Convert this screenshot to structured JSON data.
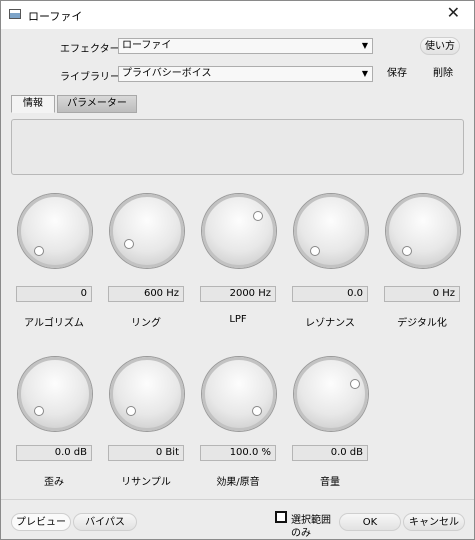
{
  "window": {
    "title": "ローファイ"
  },
  "effector": {
    "label": "エフェクター",
    "value": "ローファイ",
    "usage_button": "使い方"
  },
  "library": {
    "label": "ライブラリー",
    "value": "プライバシーボイス",
    "save_button": "保存",
    "delete_button": "削除"
  },
  "tabs": [
    {
      "label": "情報",
      "active": true
    },
    {
      "label": "パラメーター",
      "active": false
    }
  ],
  "knobs": [
    {
      "label": "アルゴリズム",
      "value": "0"
    },
    {
      "label": "リング",
      "value": "600 Hz"
    },
    {
      "label": "LPF",
      "value": "2000 Hz"
    },
    {
      "label": "レゾナンス",
      "value": "0.0"
    },
    {
      "label": "デジタル化",
      "value": "0 Hz"
    },
    {
      "label": "歪み",
      "value": "0.0 dB"
    },
    {
      "label": "リサンプル",
      "value": "0 Bit"
    },
    {
      "label": "効果/原音",
      "value": "100.0 %"
    },
    {
      "label": "音量",
      "value": "0.0 dB"
    }
  ],
  "footer": {
    "preview_button": "プレビュー",
    "bypass_button": "バイパス",
    "selection_only_line1": "選択範囲",
    "selection_only_line2": "のみ",
    "ok_button": "OK",
    "cancel_button": "キャンセル"
  }
}
